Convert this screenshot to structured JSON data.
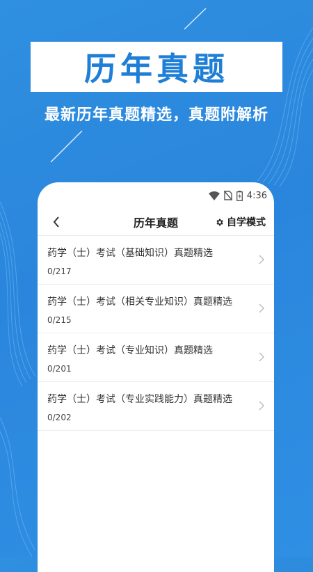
{
  "promo": {
    "banner_title": "历年真题",
    "subtitle": "最新历年真题精选，真题附解析"
  },
  "status_bar": {
    "time": "4:36",
    "icons": [
      "wifi-icon",
      "no-sim-icon",
      "battery-icon"
    ]
  },
  "nav": {
    "back_icon": "chevron-left-icon",
    "title": "历年真题",
    "mode_icon": "gear-icon",
    "mode_label": "自学模式"
  },
  "items": [
    {
      "title": "药学（士）考试（基础知识）真题精选",
      "count": "0/217"
    },
    {
      "title": "药学（士）考试（相关专业知识）真题精选",
      "count": "0/215"
    },
    {
      "title": "药学（士）考试（专业知识）真题精选",
      "count": "0/201"
    },
    {
      "title": "药学（士）考试（专业实践能力）真题精选",
      "count": "0/202"
    }
  ],
  "colors": {
    "background": "#2a86dc",
    "accent": "#1f7fd6",
    "card": "#ffffff"
  }
}
